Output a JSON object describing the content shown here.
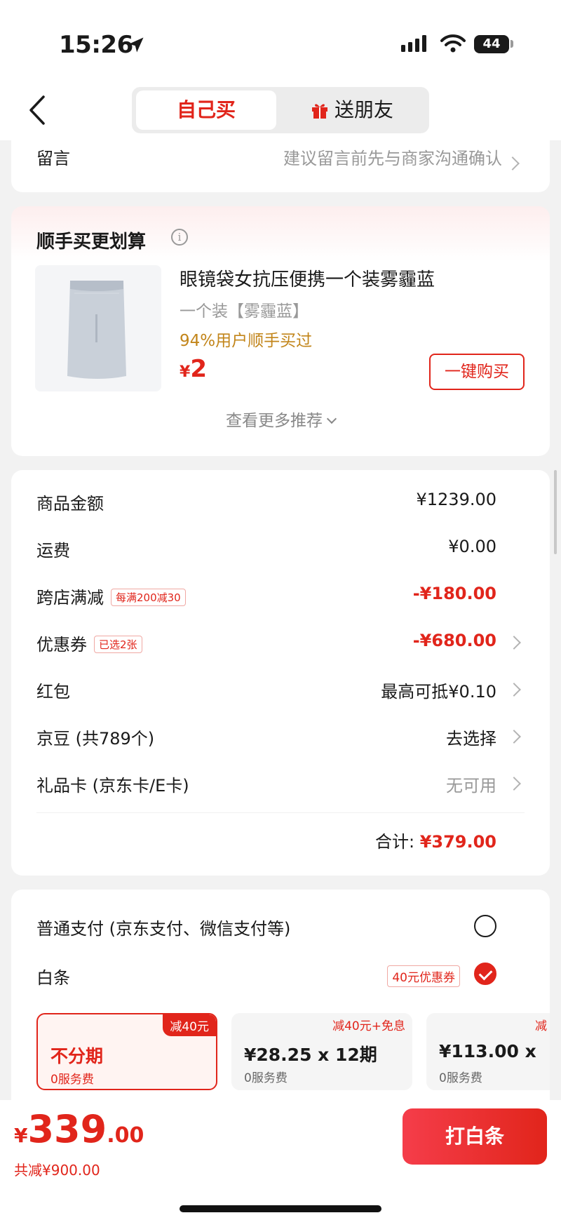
{
  "status_bar": {
    "time": "15:26",
    "battery": "44"
  },
  "nav": {
    "tab_self": "自己买",
    "tab_gift": "送朋友"
  },
  "message": {
    "label": "留言",
    "hint": "建议留言前先与商家沟通确认"
  },
  "recommend": {
    "title": "顺手买更划算",
    "product_name": "眼镜袋女抗压便携一个装雾霾蓝",
    "product_spec": "一个装【雾霾蓝】",
    "product_stat": "94%用户顺手买过",
    "price_symbol": "¥",
    "price": "2",
    "buy_label": "一键购买",
    "more_label": "查看更多推荐"
  },
  "summary": {
    "rows": [
      {
        "label": "商品金额",
        "value": "¥1239.00"
      },
      {
        "label": "运费",
        "value": "¥0.00"
      },
      {
        "label": "跨店满减",
        "tag": "每满200减30",
        "value": "-¥180.00"
      },
      {
        "label": "优惠券",
        "tag": "已选2张",
        "value": "-¥680.00"
      },
      {
        "label": "红包",
        "value": "最高可抵¥0.10"
      },
      {
        "label": "京豆 (共789个)",
        "value": "去选择"
      },
      {
        "label": "礼品卡 (京东卡/E卡)",
        "value": "无可用"
      }
    ],
    "total_label": "合计: ",
    "total_value": "¥379.00"
  },
  "payment": {
    "normal_label": "普通支付 (京东支付、微信支付等)",
    "baitiao_label": "白条",
    "coupon_tag": "40元优惠券",
    "plans": [
      {
        "badge": "减40元",
        "title": "不分期",
        "sub": "0服务费"
      },
      {
        "badge": "减40元+免息",
        "title": "¥28.25 x 12期",
        "sub": "0服务费"
      },
      {
        "badge": "减",
        "title": "¥113.00 x",
        "sub": "0服务费"
      }
    ]
  },
  "bottom": {
    "currency": "¥",
    "amount_int": "339",
    "amount_dec": ".00",
    "saved": "共减¥900.00",
    "pay_button": "打白条"
  },
  "colors": {
    "accent": "#e1251b",
    "muted": "#999999",
    "stat_gold": "#c2851a"
  },
  "icons": [
    "location-arrow-icon",
    "signal-icon",
    "wifi-icon",
    "battery-icon",
    "back-chevron-icon",
    "gift-icon",
    "info-icon",
    "chevron-right-icon",
    "chevron-down-icon",
    "check-icon"
  ]
}
